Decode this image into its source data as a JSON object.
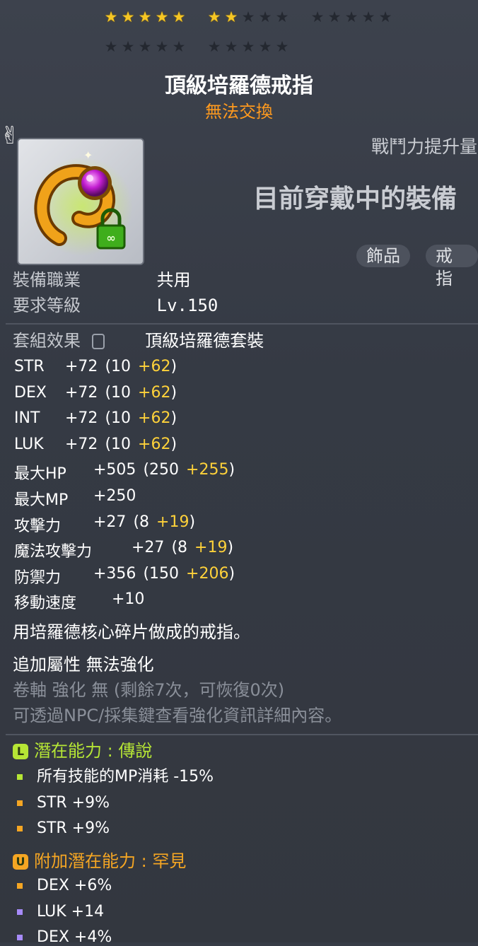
{
  "stars": {
    "total": 25,
    "filled": 7,
    "group_sizes": [
      5,
      5,
      5,
      5,
      5
    ]
  },
  "item": {
    "name": "頂級培羅德戒指",
    "tradeable": "無法交換",
    "combat_power_label": "戰鬥力提升量",
    "equipped_label": "目前穿戴中的裝備",
    "tags": [
      "飾品",
      "戒指"
    ]
  },
  "requirements": [
    {
      "label": "裝備職業",
      "value": "共用"
    },
    {
      "label": "要求等級",
      "value": "Lv.150"
    }
  ],
  "set": {
    "label": "套組效果",
    "value": "頂級培羅德套裝"
  },
  "stats": [
    {
      "name": "STR",
      "total": "+72",
      "base": "(10",
      "bonus": "+62",
      "close": ")"
    },
    {
      "name": "DEX",
      "total": "+72",
      "base": "(10",
      "bonus": "+62",
      "close": ")"
    },
    {
      "name": "INT",
      "total": "+72",
      "base": "(10",
      "bonus": "+62",
      "close": ")"
    },
    {
      "name": "LUK",
      "total": "+72",
      "base": "(10",
      "bonus": "+62",
      "close": ")"
    },
    {
      "name": "最大HP",
      "total": "+505",
      "base": "(250",
      "bonus": "+255",
      "close": ")"
    },
    {
      "name": "最大MP",
      "total": "+250",
      "base": "",
      "bonus": "",
      "close": ""
    },
    {
      "name": "攻擊力",
      "total": "+27",
      "base": "(8",
      "bonus": "+19",
      "close": ")"
    },
    {
      "name": "魔法攻擊力",
      "total": "+27",
      "base": "(8",
      "bonus": "+19",
      "close": ")"
    },
    {
      "name": "防禦力",
      "total": "+356",
      "base": "(150",
      "bonus": "+206",
      "close": ")"
    },
    {
      "name": "移動速度",
      "total": "+10",
      "base": "",
      "bonus": "",
      "close": ""
    }
  ],
  "description": "用培羅德核心碎片做成的戒指。",
  "extra": {
    "add_attr": "追加屬性 無法強化",
    "scroll": "卷軸 強化 無 (剩餘7次，可恢復0次)",
    "npc_note": "可透過NPC/採集鍵查看強化資訊詳細內容。"
  },
  "potential": {
    "badge": "L",
    "title": "潛在能力 : 傳說",
    "color": "#b6e635",
    "lines": [
      {
        "text": "所有技能的MP消耗 -15%",
        "bullet_color": "#b6e635"
      },
      {
        "text": "STR +9%",
        "bullet_color": "#f5a623"
      },
      {
        "text": "STR +9%",
        "bullet_color": "#f5a623"
      }
    ]
  },
  "additional_potential": {
    "badge": "U",
    "title": "附加潛在能力 : 罕見",
    "color": "#f5a623",
    "lines": [
      {
        "text": "DEX +6%",
        "bullet_color": "#f5a623"
      },
      {
        "text": "LUK +14",
        "bullet_color": "#a78bfa"
      },
      {
        "text": "DEX +4%",
        "bullet_color": "#a78bfa"
      }
    ]
  }
}
